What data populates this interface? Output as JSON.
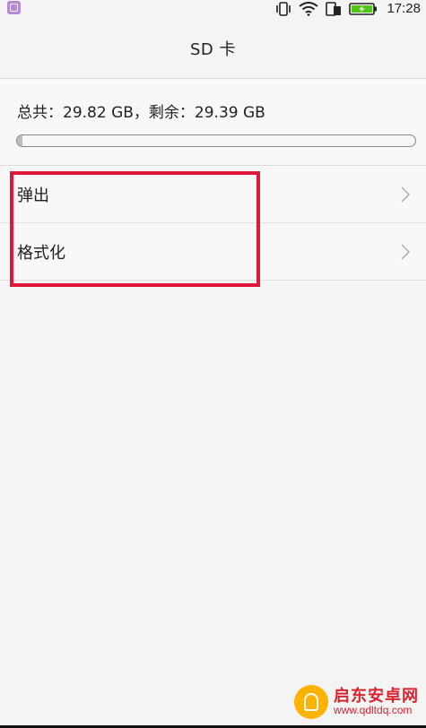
{
  "status_bar": {
    "time": "17:28",
    "icons": [
      "app-notification-icon",
      "vibrate-icon",
      "wifi-icon",
      "sim-card-icon",
      "battery-charging-icon"
    ]
  },
  "title_bar": {
    "title": "SD 卡"
  },
  "storage": {
    "summary": "总共：29.82 GB，剩余：29.39 GB",
    "used_fraction": 0.014
  },
  "menu": {
    "items": [
      {
        "label": "弹出"
      },
      {
        "label": "格式化"
      }
    ]
  },
  "watermark": {
    "title": "启东安卓网",
    "url": "www.qdltdq.com"
  },
  "colors": {
    "highlight": "#e0163b",
    "background": "#f4f4f4"
  }
}
